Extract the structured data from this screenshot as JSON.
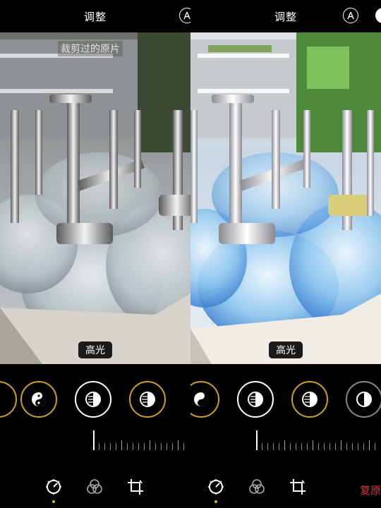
{
  "left_panel": {
    "title": "调整",
    "original_label": "裁剪过的原片",
    "param_label": "高光",
    "auto_icon": "auto-enhance-icon",
    "dials": [
      "shadows-yinyang-icon",
      "contrast-circle-icon",
      "brightness-circle-icon"
    ],
    "tabs": [
      "adjust-dial-icon",
      "filters-circles-icon",
      "crop-rotate-icon"
    ]
  },
  "right_panel": {
    "title": "调整",
    "param_label": "高光",
    "auto_icon": "auto-enhance-icon",
    "dials": [
      "shadows-yinyang-icon",
      "contrast-circle-icon",
      "brightness-circle-icon"
    ],
    "tabs": [
      "adjust-dial-icon",
      "filters-circles-icon",
      "crop-rotate-icon"
    ],
    "reset_label": "复原"
  },
  "colors": {
    "accent": "#c9a227",
    "active_dot": "#e5b300",
    "reset": "#e0322d"
  }
}
